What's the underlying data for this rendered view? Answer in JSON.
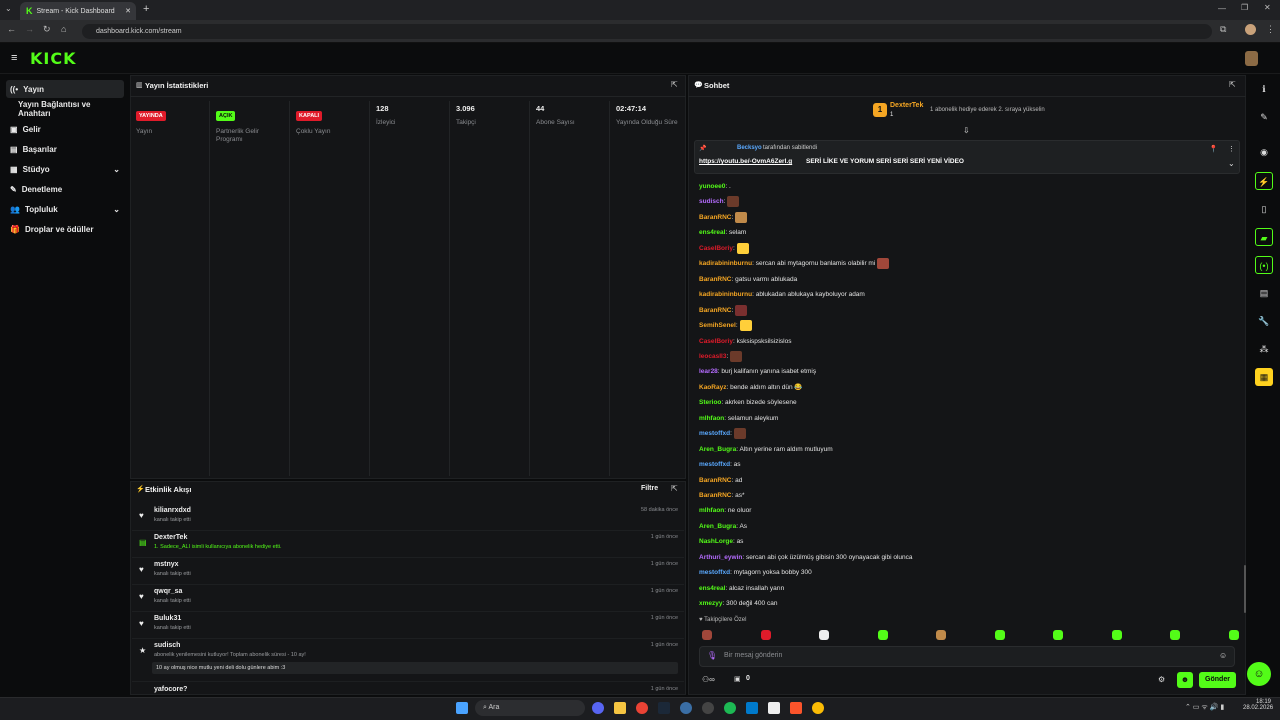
{
  "browser": {
    "tab_title": "Stream - Kick Dashboard",
    "url": "dashboard.kick.com/stream"
  },
  "header": {
    "logo": "KICK"
  },
  "sidebar": {
    "items": [
      {
        "label": "Yayın",
        "icon": "broadcast-icon"
      },
      {
        "label": "Yayın Bağlantısı ve Anahtarı",
        "icon": ""
      },
      {
        "label": "Gelir",
        "icon": "wallet-icon"
      },
      {
        "label": "Başarılar",
        "icon": "trophy-icon"
      },
      {
        "label": "Stüdyo",
        "icon": "studio-icon"
      },
      {
        "label": "Denetleme",
        "icon": "wrench-icon"
      },
      {
        "label": "Topluluk",
        "icon": "people-icon"
      },
      {
        "label": "Droplar ve ödüller",
        "icon": "gift-icon"
      }
    ]
  },
  "stats": {
    "title": "Yayın İstatistikleri",
    "cols": [
      {
        "badge": "YAYINDA",
        "badge_color": "#e01b2a",
        "label": "Yayın"
      },
      {
        "badge": "AÇIK",
        "badge_color": "#53fc18",
        "label": "Partnerlik Gelir Programı"
      },
      {
        "badge": "KAPALI",
        "badge_color": "#e01b2a",
        "label": "Çoklu Yayın"
      },
      {
        "value": "128",
        "label": "İzleyici"
      },
      {
        "value": "3.096",
        "label": "Takipçi"
      },
      {
        "value": "44",
        "label": "Abone Sayısı"
      },
      {
        "value": "02:47:14",
        "label": "Yayında Olduğu Süre"
      }
    ]
  },
  "activity": {
    "title": "Etkinlik Akışı",
    "filter": "Filtre",
    "events": [
      {
        "name": "kilianrxdxd",
        "desc": "kanalı takip etti",
        "time": "58 dakika önce",
        "icon": "heart-icon"
      },
      {
        "name": "DexterTek",
        "desc": "1. Sadece_ALI isimli kullanıcıya abonelik hediye etti.",
        "time": "1 gün önce",
        "icon": "gift-icon"
      },
      {
        "name": "mstnyx",
        "desc": "kanalı takip etti",
        "time": "1 gün önce",
        "icon": "heart-icon"
      },
      {
        "name": "qwqr_sa",
        "desc": "kanalı takip etti",
        "time": "1 gün önce",
        "icon": "heart-icon"
      },
      {
        "name": "Buluk31",
        "desc": "kanalı takip etti",
        "time": "1 gün önce",
        "icon": "heart-icon"
      },
      {
        "name": "sudisch",
        "desc": "abonelik yenilemesini kutluyor! Toplam abonelik süresi - 10 ay!",
        "time": "1 gün önce",
        "icon": "star-icon",
        "message": "10 ay olmuş nice mutlu yeni deli dolu günlere abim :3"
      },
      {
        "name": "yafocore?",
        "desc": "",
        "time": "1 gün önce",
        "icon": "heart-icon"
      }
    ]
  },
  "chat": {
    "title": "Sohbet",
    "gifter": {
      "name": "DexterTek",
      "count": "1",
      "note": "1 abonelik hediye ederek 2. sıraya yükselin"
    },
    "pinned": {
      "by": "Becksyo",
      "by_suffix": "tarafından sabitlendi",
      "link": "https://youtu.be/-OvmA6Zerl.g",
      "text": "SERİ LİKE VE YORUM SERİ SERİ SERİ YENİ VİDEO"
    },
    "messages": [
      {
        "user": "yunoee0",
        "color": "#53fc18",
        "text": ": ."
      },
      {
        "user": "sudisch",
        "color": "#b56cff",
        "text": ":",
        "emote": true
      },
      {
        "user": "BaranRNC",
        "color": "#f5a623",
        "text": ":",
        "emote": true
      },
      {
        "user": "ens4real",
        "color": "#53fc18",
        "text": ": selam"
      },
      {
        "user": "CaselBoriy",
        "color": "#e01b2a",
        "text": ":",
        "emote": true
      },
      {
        "user": "kadirabininburnu",
        "color": "#f5a623",
        "text": ": sercan abi mytagornu banlamis olabilir mi",
        "emote": true
      },
      {
        "user": "BaranRNC",
        "color": "#f5a623",
        "text": ": gatsu varmı ablukada"
      },
      {
        "user": "kadirabininburnu",
        "color": "#f5a623",
        "text": ": ablukadan ablukaya kayboluyor adam"
      },
      {
        "user": "BaranRNC",
        "color": "#f5a623",
        "text": ":",
        "emote": true
      },
      {
        "user": "SemihSenel",
        "color": "#f5a623",
        "text": ":",
        "emote": true
      },
      {
        "user": "CaselBoriy",
        "color": "#e01b2a",
        "text": ": ksksispsksilsizislos"
      },
      {
        "user": "leocasIl3",
        "color": "#e01b2a",
        "text": ":",
        "emote": true
      },
      {
        "user": "lear28",
        "color": "#b56cff",
        "text": ": burj kalifanın yanına isabet etmiş"
      },
      {
        "user": "KaoRayz",
        "color": "#f5a623",
        "text": ": bende aldım altın dün 😂"
      },
      {
        "user": "Sterioo",
        "color": "#53fc18",
        "text": ": akrken bizede söylesene"
      },
      {
        "user": "mlhfaon",
        "color": "#53fc18",
        "text": ": selamun aleykum"
      },
      {
        "user": "mestoffxd",
        "color": "#5aa9ff",
        "text": ":",
        "emote": true
      },
      {
        "user": "Aren_Bugra",
        "color": "#53fc18",
        "text": ": Altın yerine ram aldım mutluyum"
      },
      {
        "user": "mestoffxd",
        "color": "#5aa9ff",
        "text": ": as"
      },
      {
        "user": "BaranRNC",
        "color": "#f5a623",
        "text": ": ad"
      },
      {
        "user": "BaranRNC",
        "color": "#f5a623",
        "text": ": as*"
      },
      {
        "user": "mlhfaon",
        "color": "#53fc18",
        "text": ": ne oluor"
      },
      {
        "user": "Aren_Bugra",
        "color": "#53fc18",
        "text": ": As"
      },
      {
        "user": "NashLorge",
        "color": "#53fc18",
        "text": ": as"
      },
      {
        "user": "Arthuri_eywin",
        "color": "#b56cff",
        "text": ": sercan abi çok üzülmüş gibisin 300 oynayacak gibi olunca"
      },
      {
        "user": "mestoffxd",
        "color": "#5aa9ff",
        "text": ": mytagorn yoksa bobby 300"
      },
      {
        "user": "ens4real",
        "color": "#53fc18",
        "text": ": alcaz insallah yarın"
      },
      {
        "user": "xmezyy",
        "color": "#53fc18",
        "text": ": 300 değil 400 can"
      }
    ],
    "followers_only": "Takipçilere Özel",
    "input_placeholder": "Bir mesaj gönderin",
    "points": "0",
    "send": "Gönder"
  },
  "taskbar": {
    "search": "Ara",
    "time": "18:19",
    "date": "28.02.2026"
  },
  "colors": {
    "accent": "#53fc18",
    "live": "#e01b2a"
  }
}
